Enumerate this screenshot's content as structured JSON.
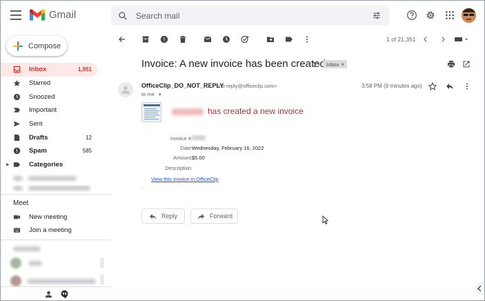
{
  "app": {
    "name": "Gmail"
  },
  "search": {
    "placeholder": "Search mail"
  },
  "compose": {
    "label": "Compose"
  },
  "nav": [
    {
      "id": "inbox",
      "label": "Inbox",
      "count": "1,951",
      "icon": "inbox-icon",
      "active": true
    },
    {
      "id": "starred",
      "label": "Starred",
      "count": "",
      "icon": "star-icon"
    },
    {
      "id": "snoozed",
      "label": "Snoozed",
      "count": "",
      "icon": "clock-icon"
    },
    {
      "id": "important",
      "label": "Important",
      "count": "",
      "icon": "important-icon"
    },
    {
      "id": "sent",
      "label": "Sent",
      "count": "",
      "icon": "send-icon"
    },
    {
      "id": "drafts",
      "label": "Drafts",
      "count": "12",
      "icon": "draft-icon",
      "bold": true
    },
    {
      "id": "spam",
      "label": "Spam",
      "count": "585",
      "icon": "spam-icon",
      "bold": true
    },
    {
      "id": "categories",
      "label": "Categories",
      "count": "",
      "icon": "label-icon",
      "bold": true
    }
  ],
  "meet": {
    "title": "Meet",
    "items": [
      {
        "label": "New meeting",
        "icon": "video-icon"
      },
      {
        "label": "Join a meeting",
        "icon": "keyboard-icon"
      }
    ]
  },
  "pager": {
    "text": "1 of 21,351"
  },
  "email": {
    "subject": "Invoice: A new invoice has been created",
    "label_chip": "Inbox",
    "chip_close": "×",
    "sender_name": "OfficeClip_DO_NOT_REPLY",
    "sender_email": "<no-reply@officeclip.com>",
    "to": "to me",
    "time": "3:58 PM (0 minutes ago)",
    "headline": "has created a new invoice",
    "fields": [
      {
        "key": "Invoice #:",
        "value": ""
      },
      {
        "key": "Date:",
        "value": "Wednesday, February 16, 2022"
      },
      {
        "key": "Amount:",
        "value": "$5.00"
      },
      {
        "key": "Description:",
        "value": ""
      }
    ],
    "link_text": "View this invoice in OfficeClip",
    "dot": ".",
    "reply_label": "Reply",
    "forward_label": "Forward"
  },
  "colors": {
    "accent": "#d93025",
    "active_bg": "#fce8e6",
    "link": "#1a55c8",
    "headline": "#a83232"
  }
}
